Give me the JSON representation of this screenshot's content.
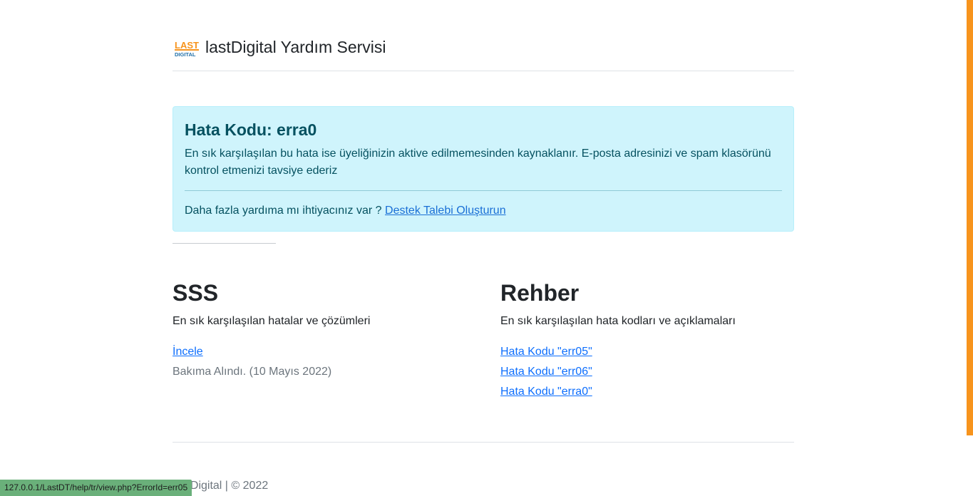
{
  "header": {
    "logo_top": "LAST",
    "logo_bottom": "DIGITAL",
    "title": "lastDigital Yardım Servisi"
  },
  "alert": {
    "heading": "Hata Kodu: erra0",
    "message": "En sık karşılaşılan bu hata ise üyeliğinizin aktive edilmemesinden kaynaklanır. E-posta adresinizi ve spam klasörünü kontrol etmenizi tavsiye ederiz",
    "help_text": "Daha fazla yardıma mı ihtiyacınız var ?",
    "help_link": "Destek Talebi Oluşturun"
  },
  "faq": {
    "title": "SSS",
    "description": "En sık karşılaşılan hatalar ve çözümleri",
    "link": "İncele",
    "status": "Bakıma Alındı. (10 Mayıs 2022)"
  },
  "guide": {
    "title": "Rehber",
    "description": "En sık karşılaşılan hata kodları ve açıklamaları",
    "links": [
      "Hata Kodu \"err05\"",
      "Hata Kodu \"err06\"",
      "Hata Kodu \"erra0\""
    ]
  },
  "footer": {
    "text": "lastDigital | © 2022"
  },
  "status_bar": {
    "url": "127.0.0.1/LastDT/help/tr/view.php?ErrorId=err05"
  },
  "colors": {
    "accent": "#f7941d",
    "alert_bg": "#cff4fc",
    "link": "#0d6efd"
  }
}
